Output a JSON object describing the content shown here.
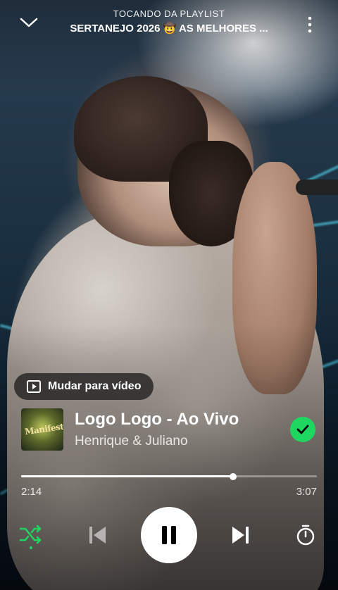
{
  "header": {
    "context_label": "TOCANDO DA PLAYLIST",
    "context_title": "SERTANEJO 2026 🤠 AS MELHORES ..."
  },
  "video_switch": {
    "label": "Mudar para vídeo"
  },
  "track": {
    "title": "Logo Logo - Ao Vivo",
    "artist": "Henrique & Juliano",
    "cover_text": "Manifesto",
    "liked": true
  },
  "playback": {
    "elapsed": "2:14",
    "duration": "3:07",
    "progress": 0.717,
    "shuffle_on": true,
    "is_playing": true
  },
  "colors": {
    "accent": "#1ed760",
    "text": "#ffffff"
  },
  "icons": {
    "collapse": "chevron-down-icon",
    "more": "more-vertical-icon",
    "video": "play-video-icon",
    "liked": "check-icon",
    "shuffle": "shuffle-icon",
    "previous": "skip-previous-icon",
    "pause": "pause-icon",
    "next": "skip-next-icon",
    "timer": "sleep-timer-icon"
  }
}
